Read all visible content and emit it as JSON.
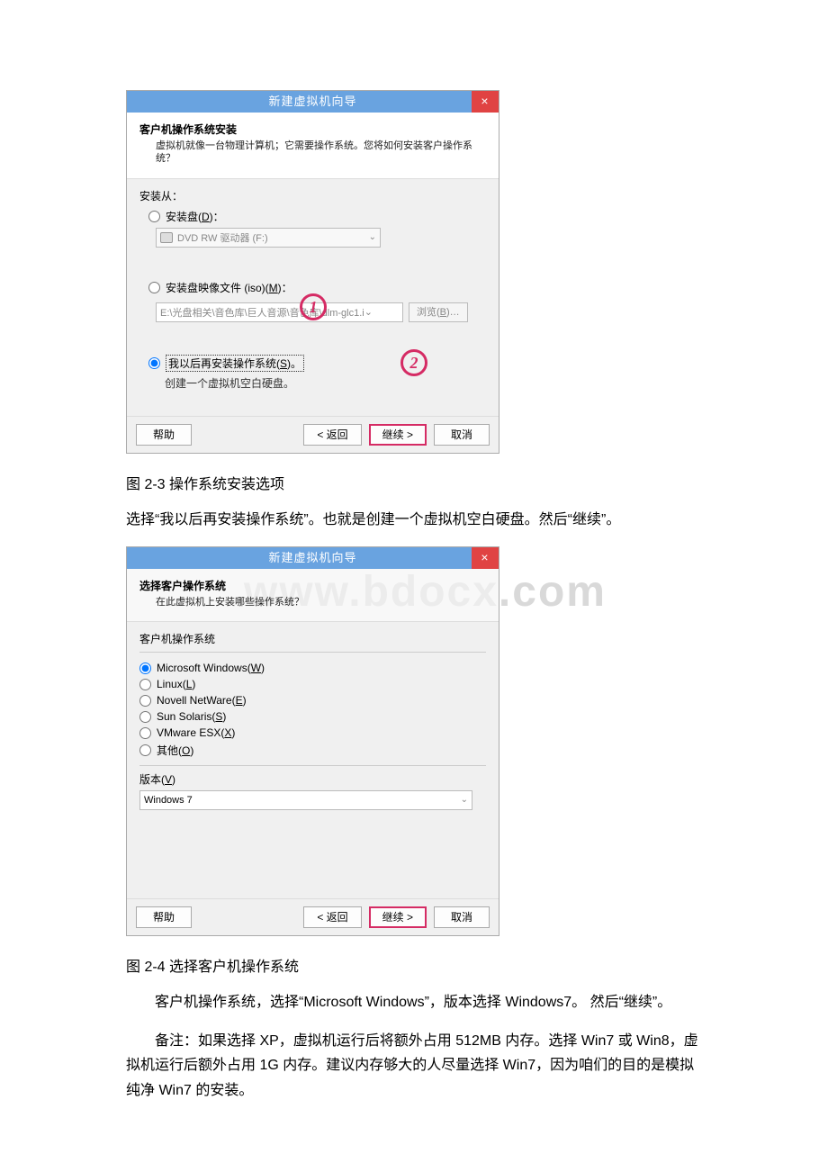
{
  "dialog1": {
    "title": "新建虚拟机向导",
    "close": "×",
    "header_title": "客户机操作系统安装",
    "header_sub": "虚拟机就像一台物理计算机；它需要操作系统。您将如何安装客户操作系统？",
    "install_from": "安装从：",
    "radio_disc": "安装盘(",
    "radio_disc_u": "D",
    "radio_disc_end": ")：",
    "drive": "DVD RW 驱动器 (F:)",
    "radio_iso": "安装盘映像文件 (iso)(",
    "radio_iso_u": "M",
    "radio_iso_end": ")：",
    "iso_path": "E:\\光盘相关\\音色库\\巨人音源\\音色库\\dlm-glc1.i",
    "browse": "浏览(",
    "browse_u": "B",
    "browse_end": ")…",
    "radio_later": "我以后再安装操作系统(",
    "radio_later_u": "S",
    "radio_later_end": ")。",
    "later_hint": "创建一个虚拟机空白硬盘。",
    "help": "帮助",
    "back": "< 返回",
    "next": "继续 >",
    "cancel": "取消",
    "stamp1": "1",
    "stamp2": "2"
  },
  "caption1": "图 2-3 操作系统安装选项",
  "para1": "选择“我以后再安装操作系统”。也就是创建一个虚拟机空白硬盘。然后“继续”。",
  "dialog2": {
    "title": "新建虚拟机向导",
    "close": "×",
    "header_title": "选择客户操作系统",
    "header_sub": "在此虚拟机上安装哪些操作系统？",
    "group_label": "客户机操作系统",
    "os_win": "Microsoft Windows(",
    "os_win_u": "W",
    "os_win_end": ")",
    "os_linux": "Linux(",
    "os_linux_u": "L",
    "os_linux_end": ")",
    "os_netware": "Novell NetWare(",
    "os_netware_u": "E",
    "os_netware_end": ")",
    "os_sun": "Sun Solaris(",
    "os_sun_u": "S",
    "os_sun_end": ")",
    "os_esx": "VMware ESX(",
    "os_esx_u": "X",
    "os_esx_end": ")",
    "os_other": "其他(",
    "os_other_u": "O",
    "os_other_end": ")",
    "ver_label": "版本(",
    "ver_u": "V",
    "ver_end": ")",
    "ver_value": "Windows 7",
    "help": "帮助",
    "back": "< 返回",
    "next": "继续 >",
    "cancel": "取消"
  },
  "caption2": "图 2-4 选择客户机操作系统",
  "para2": "客户机操作系统，选择“Microsoft Windows”，版本选择 Windows7。 然后“继续”。",
  "para3": "备注：如果选择 XP，虚拟机运行后将额外占用 512MB 内存。选择 Win7 或 Win8，虚拟机运行后额外占用 1G 内存。建议内存够大的人尽量选择 Win7，因为咱们的目的是模拟纯净 Win7 的安装。",
  "watermark": "www.bdocx.com"
}
